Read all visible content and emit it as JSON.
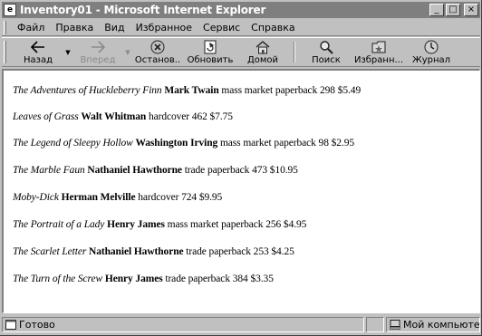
{
  "window": {
    "title": "Inventory01 - Microsoft Internet Explorer"
  },
  "menu": [
    {
      "label": "Файл"
    },
    {
      "label": "Правка"
    },
    {
      "label": "Вид"
    },
    {
      "label": "Избранное"
    },
    {
      "label": "Сервис"
    },
    {
      "label": "Справка"
    }
  ],
  "toolbar": {
    "back": "Назад",
    "forward": "Вперед",
    "stop": "Останов..",
    "refresh": "Обновить",
    "home": "Домой",
    "search": "Поиск",
    "favorites": "Избранн...",
    "history": "Журнал"
  },
  "books": [
    {
      "title": "The Adventures of Huckleberry Finn",
      "author": "Mark Twain",
      "details": "mass market paperback 298 $5.49"
    },
    {
      "title": "Leaves of Grass",
      "author": "Walt Whitman",
      "details": "hardcover 462 $7.75"
    },
    {
      "title": "The Legend of Sleepy Hollow",
      "author": "Washington Irving",
      "details": "mass market paperback 98 $2.95"
    },
    {
      "title": "The Marble Faun",
      "author": "Nathaniel Hawthorne",
      "details": "trade paperback 473 $10.95"
    },
    {
      "title": "Moby-Dick",
      "author": "Herman Melville",
      "details": "hardcover 724 $9.95"
    },
    {
      "title": "The Portrait of a Lady",
      "author": "Henry James",
      "details": "mass market paperback 256 $4.95"
    },
    {
      "title": "The Scarlet Letter",
      "author": "Nathaniel Hawthorne",
      "details": "trade paperback 253 $4.25"
    },
    {
      "title": "The Turn of the Screw",
      "author": "Henry James",
      "details": "trade paperback 384 $3.35"
    }
  ],
  "status": {
    "text": "Готово",
    "zone": "Мой компьютер"
  }
}
